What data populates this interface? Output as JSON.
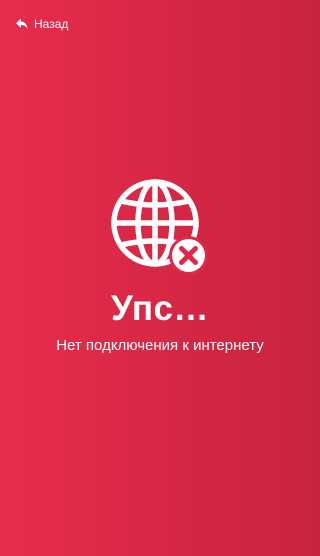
{
  "colors": {
    "background_start": "#e82c4d",
    "background_end": "#c7233f",
    "foreground": "#ffffff"
  },
  "header": {
    "back_icon": "reply-arrow-icon",
    "back_label": "Назад"
  },
  "error": {
    "icon": "globe-icon",
    "badge_icon": "close-circle-icon",
    "title": "Упс…",
    "message": "Нет подключения к интернету"
  }
}
